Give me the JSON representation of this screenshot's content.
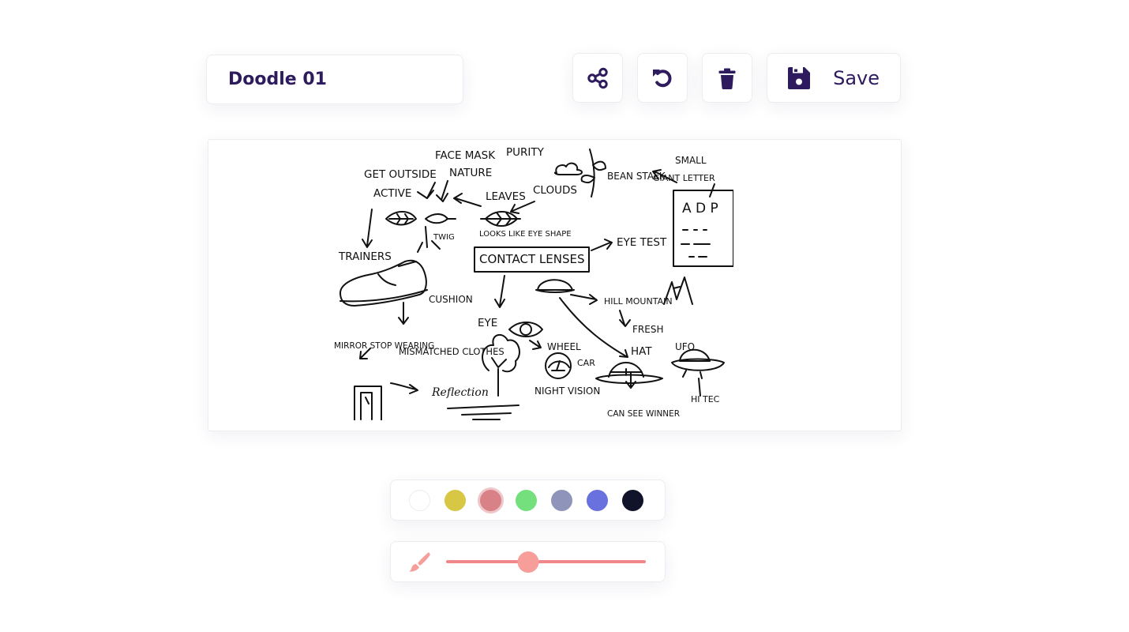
{
  "doodle": {
    "title": "Doodle 01"
  },
  "toolbar": {
    "share_icon": "share-icon",
    "undo_icon": "undo-icon",
    "delete_icon": "trash-icon",
    "save_icon": "floppy-disk-icon",
    "save_label": "Save"
  },
  "canvas": {
    "sketch_labels": [
      "FACE MASK",
      "PURITY",
      "GET OUTSIDE",
      "NATURE",
      "ACTIVE",
      "LEAVES",
      "CLOUDS",
      "BEAN STALK",
      "SMALL",
      "GIANT LETTER",
      "A D P",
      "TWIG",
      "LOOKS LIKE EYE SHAPE",
      "TRAINERS",
      "CONTACT LENSES",
      "EYE TEST",
      "CUSHION",
      "HILL MOUNTAIN",
      "FRESH",
      "EYE",
      "MIRROR STOP WEARING",
      "MISMATCHED CLOTHES",
      "WHEEL",
      "HAT",
      "UFO",
      "CAR",
      "NIGHT VISION",
      "Reflection",
      "HI TEC",
      "CAN SEE WINNER"
    ]
  },
  "palette": {
    "selected_index": 2,
    "colors": [
      "#ffffff",
      "#d8c645",
      "#d88288",
      "#74e07d",
      "#8f94bb",
      "#6971df",
      "#11132b"
    ]
  },
  "brush": {
    "icon": "paintbrush-icon",
    "color": "#f79d9a",
    "size_fraction": 0.41
  },
  "theme": {
    "accent": "#2d1b5e"
  }
}
